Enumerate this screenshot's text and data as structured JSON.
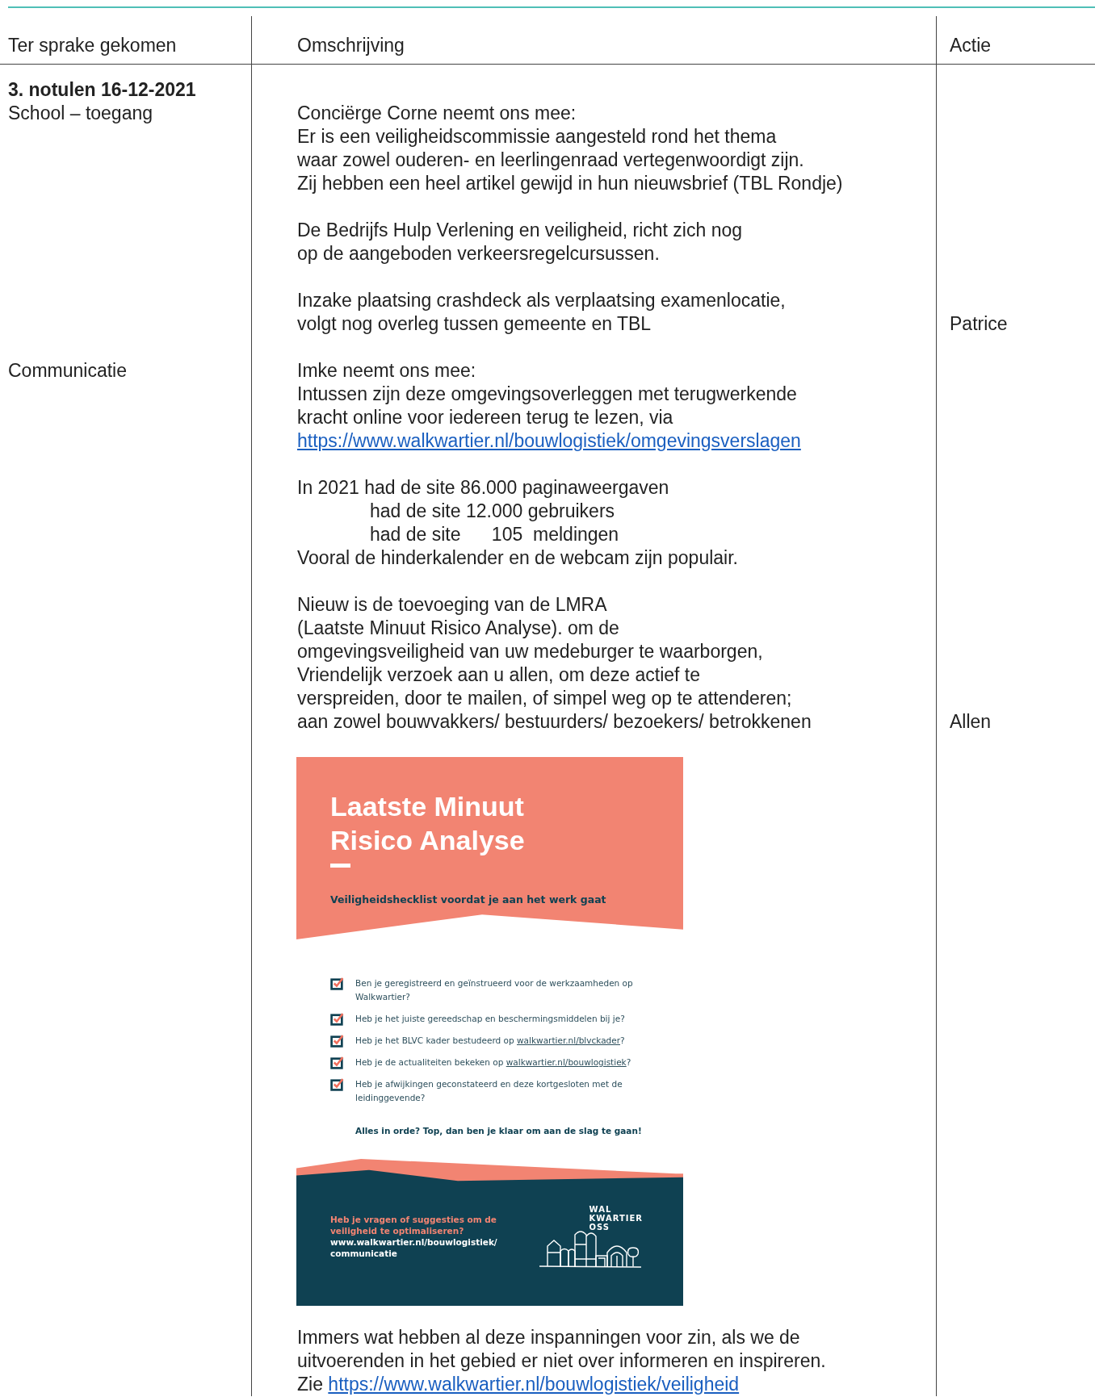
{
  "table": {
    "columns": [
      "Ter sprake gekomen",
      "Omschrijving",
      "Actie"
    ],
    "rows": [
      {
        "kind": "heading",
        "topic": "3. notulen 16-12-2021"
      },
      {
        "kind": "text",
        "topic": "School – toegang",
        "lines": [
          {
            "kind": "text",
            "text": "Conciërge Corne neemt ons mee:"
          },
          {
            "kind": "text",
            "text": "Er is een veiligheidscommissie aangesteld rond het thema"
          },
          {
            "kind": "text",
            "text": "waar zowel ouderen- en leerlingenraad vertegenwoordigt zijn."
          },
          {
            "kind": "text",
            "text": "Zij hebben een heel artikel gewijd in hun nieuwsbrief (TBL Rondje)"
          }
        ]
      },
      {
        "kind": "text",
        "lines": [
          {
            "kind": "text",
            "text": "De Bedrijfs Hulp Verlening en veiligheid, richt zich nog"
          },
          {
            "kind": "text",
            "text": "op de aangeboden verkeersregelcursussen."
          }
        ]
      },
      {
        "kind": "text",
        "action": "Patrice",
        "lines": [
          {
            "kind": "text",
            "text": "Inzake plaatsing crashdeck als verplaatsing examenlocatie,"
          },
          {
            "kind": "text",
            "text": "volgt nog overleg tussen gemeente en TBL"
          }
        ]
      },
      {
        "kind": "text",
        "topic": "Communicatie",
        "lines": [
          {
            "kind": "text",
            "text": "Imke neemt ons mee:"
          },
          {
            "kind": "text",
            "text": "Intussen zijn deze omgevingsoverleggen met terugwerkende"
          },
          {
            "kind": "text",
            "text": "kracht online voor iedereen terug te lezen, via"
          },
          {
            "kind": "link",
            "text": "https://www.walkwartier.nl/bouwlogistiek/omgevingsverslagen"
          }
        ]
      },
      {
        "kind": "text",
        "lines": [
          {
            "kind": "text",
            "text": "In 2021 had de site 86.000 paginaweergaven"
          },
          {
            "kind": "indent",
            "text": "had de site 12.000 gebruikers"
          },
          {
            "kind": "indent",
            "text": "had de site      105  meldingen"
          },
          {
            "kind": "text",
            "text": "Vooral de hinderkalender en de webcam zijn populair."
          }
        ]
      },
      {
        "kind": "text",
        "action": "Allen",
        "lines": [
          {
            "kind": "text",
            "text": "Nieuw is de toevoeging van de LMRA"
          },
          {
            "kind": "text",
            "text": "(Laatste Minuut Risico Analyse). om de"
          },
          {
            "kind": "text",
            "text": "omgevingsveiligheid van uw medeburger te waarborgen,"
          },
          {
            "kind": "text",
            "text": "Vriendelijk verzoek aan u allen, om deze actief te"
          },
          {
            "kind": "text",
            "text": "verspreiden, door te mailen, of simpel weg op te attenderen;"
          },
          {
            "kind": "text",
            "text": "aan zowel bouwvakkers/ bestuurders/ bezoekers/ betrokkenen"
          }
        ]
      },
      {
        "kind": "flyer",
        "flyer": {
          "title_lines": [
            "Laatste Minuut",
            "Risico Analyse"
          ],
          "subtitle": "Veiligheidshecklist voordat je aan het werk gaat",
          "checklist": [
            {
              "text": "Ben je geregistreerd en geïnstrueerd voor de werkzaamheden op Walkwartier?",
              "checked": true
            },
            {
              "text": "Heb je het juiste gereedschap en beschermingsmiddelen bij je?",
              "checked": true
            },
            {
              "text": "Heb je het BLVC kader bestudeerd op ",
              "link": "walkwartier.nl/blvckader",
              "after": "?",
              "checked": true
            },
            {
              "text": "Heb je de actualiteiten bekeken op ",
              "link": "walkwartier.nl/bouwlogistiek",
              "after": "?",
              "checked": true
            },
            {
              "text": "Heb je afwijkingen geconstateerd en deze kortgesloten met de leidinggevende?",
              "checked": true
            }
          ],
          "closing": "Alles in orde? Top, dan ben je klaar om aan de slag te gaan!",
          "question": "Heb je vragen of suggesties om de veiligheid te optimaliseren?",
          "url": "www.walkwartier.nl/bouwlogistiek/ communicatie",
          "logo_lines": [
            "WAL",
            "KWARTIER",
            "OSS"
          ]
        }
      },
      {
        "kind": "text",
        "lines": [
          {
            "kind": "text",
            "text": "Immers wat hebben al deze inspanningen voor zin, als we de"
          },
          {
            "kind": "text",
            "text": "uitvoerenden in het gebied er niet over informeren en inspireren."
          },
          {
            "kind": "mixed",
            "text": "Zie ",
            "link": "https://www.walkwartier.nl/bouwlogistiek/veiligheid"
          }
        ]
      }
    ]
  }
}
